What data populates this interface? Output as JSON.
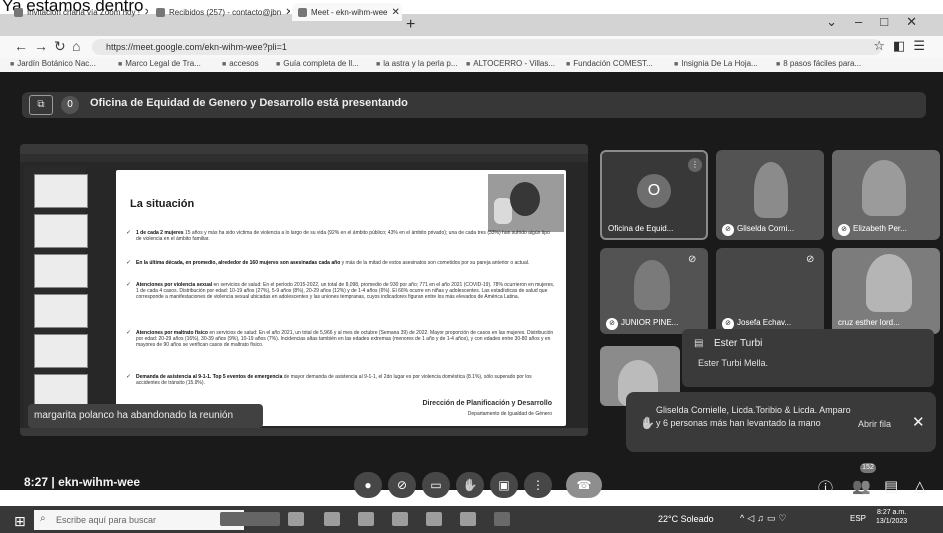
{
  "caption": "Ya estamos dentro",
  "browser": {
    "tabs": [
      {
        "label": "Invitación charla vía Zoom hoy !",
        "active": false
      },
      {
        "label": "Recibidos (257) - contacto@jbn",
        "active": false
      },
      {
        "label": "Meet - ekn-wihm-wee",
        "active": true
      }
    ],
    "url": "https://meet.google.com/ekn-wihm-wee?pli=1",
    "bookmarks": [
      "Jardín Botánico Nac...",
      "Marco Legal de Tra...",
      "accesos",
      "Guía completa de ll...",
      "la astra y la perla p...",
      "ALTOCERRO - Villas...",
      "Fundación COMEST...",
      "Insignia De La Hoja...",
      "8 pasos fáciles para..."
    ]
  },
  "meet": {
    "presenter_count": "0",
    "presenting_banner": "Oficina de Equidad de Genero y Desarrollo está presentando",
    "left_notice": "margarita polanco ha abandonado la reunión",
    "slide": {
      "title": "La situación",
      "bullets": [
        {
          "bold": "1 de cada 2 mujeres",
          "text": " 15 años y más ha sido víctima de violencia a lo largo de su vida (92% en el ámbito público; 43% en el ámbito privado); una de cada tres (33%) han sufrido algún tipo de violencia en el ámbito familiar."
        },
        {
          "bold": "En la última década, en promedio, alrededor de 160 mujeres son asesinadas cada año",
          "text": " y más de la mitad de estos asesinatos son cometidos por su pareja anterior o actual."
        },
        {
          "bold": "Atenciones por violencia sexual",
          "text": " en servicios de salud: En el período 2015-2022, un total de 8,098, promedio de 930 por año; 771 en el año 2021 (COVID-19). 78% ocurrieron en mujeres, 1 de cada 4 casos. Distribución por edad: 10-19 años (27%), 5-9 años (8%), 20-29 años (12%) y de 1-4 años (6%). El 66% ocurre en niñas y adolescentes. Las estadísticas de salud que corresponde a manifestaciones de violencia sexual ubicadas en adolescentes y las uniones tempranas, cuyos indicadores figuran entre los más elevados de América Latina."
        },
        {
          "bold": "Atenciones por maltrato físico",
          "text": " en servicios de salud: En el año 2021, un total de 5,966 y al mes de octubre (Semana 39) de 2022. Mayor proporción de casos en las mujeres. Distribución por edad: 20-29 años (16%), 30-39 años (9%), 10-19 años (7%). Incidencias altas también en las edades extremas (menores de 1 año y de 1-4 años), y con edades entre 30-80 años y en mayores de 90 años se verifican casos de maltrato físico."
        },
        {
          "bold": "Demanda de asistencia al 9-1-1. Top 5 eventos de emergencia",
          "text": " de mayor demanda de asistencia al 9-1-1, el 2do lugar es por violencia doméstica (8.1%), sólo superado por los accidentes de tránsito (15.9%)."
        }
      ],
      "footer_title": "Dirección de Planificación y Desarrollo",
      "footer_sub": "Departamento de Igualdad de Género"
    },
    "tiles": [
      {
        "name": "Oficina de Equid...",
        "avatar": "O"
      },
      {
        "name": "Gliselda Corni..."
      },
      {
        "name": "Elizabeth Per..."
      },
      {
        "name": "JUNIOR PINE..."
      },
      {
        "name": "Josefa Echav..."
      },
      {
        "name": "cruz esther lord..."
      }
    ],
    "chat": {
      "sender": "Ester Turbi",
      "message": "Ester Turbi Mella."
    },
    "hands": {
      "text": "Gliselda Cornielle, Licda.Toribio & Licda. Amparo y 6 personas más han levantado la mano",
      "open_label": "Abrir fila"
    },
    "controls": {
      "time": "8:27",
      "meeting_code": "ekn-wihm-wee",
      "participants_badge": "152"
    }
  },
  "taskbar": {
    "search_placeholder": "Escribe aquí para buscar",
    "weather": "22°C Soleado",
    "language": "ESP",
    "clock_time": "8:27 a.m.",
    "clock_date": "13/1/2023"
  }
}
